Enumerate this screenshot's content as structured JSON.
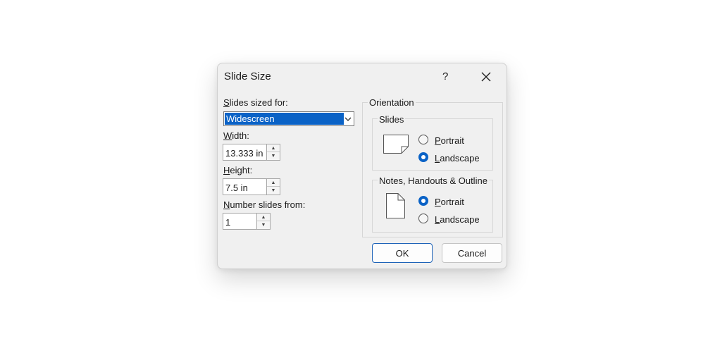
{
  "dialog": {
    "title": "Slide Size",
    "help_label": "?",
    "close_icon": "close-icon"
  },
  "left": {
    "slides_sized_for": {
      "mnemonic": "S",
      "label_rest": "lides sized for:",
      "value": "Widescreen"
    },
    "width": {
      "mnemonic": "W",
      "label_rest": "idth:",
      "value": "13.333 in"
    },
    "height": {
      "mnemonic": "H",
      "label_rest": "eight:",
      "value": "7.5 in"
    },
    "number_from": {
      "mnemonic": "N",
      "label_rest": "umber slides from:",
      "value": "1"
    }
  },
  "orientation": {
    "title": "Orientation",
    "slides": {
      "title": "Slides",
      "portrait": {
        "mnemonic": "P",
        "rest": "ortrait",
        "selected": false
      },
      "landscape": {
        "mnemonic": "L",
        "rest": "andscape",
        "selected": true
      }
    },
    "notes": {
      "title": "Notes, Handouts & Outline",
      "portrait": {
        "mnemonic": "P",
        "rest": "ortrait",
        "selected": true
      },
      "landscape": {
        "mnemonic": "L",
        "rest": "andscape",
        "selected": false
      }
    }
  },
  "buttons": {
    "ok": "OK",
    "cancel": "Cancel"
  },
  "colors": {
    "accent": "#0a62c6",
    "dialog_bg": "#f0f0f0"
  }
}
